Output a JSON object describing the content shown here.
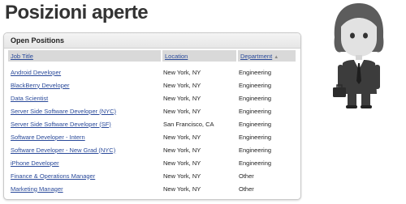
{
  "page": {
    "title": "Posizioni aperte"
  },
  "panel": {
    "title": "Open Positions"
  },
  "table": {
    "headers": {
      "job_title": "Job Title",
      "location": "Location",
      "department": "Department"
    },
    "rows": [
      {
        "title": "Android Developer",
        "location": "New York, NY",
        "department": "Engineering"
      },
      {
        "title": "BlackBerry Developer",
        "location": "New York, NY",
        "department": "Engineering"
      },
      {
        "title": "Data Scientist",
        "location": "New York, NY",
        "department": "Engineering"
      },
      {
        "title": "Server Side Software Developer (NYC)",
        "location": "New York, NY",
        "department": "Engineering"
      },
      {
        "title": "Server Side Software Developer (SF)",
        "location": "San Francisco, CA",
        "department": "Engineering"
      },
      {
        "title": "Software Developer - Intern",
        "location": "New York, NY",
        "department": "Engineering"
      },
      {
        "title": "Software Developer - New Grad (NYC)",
        "location": "New York, NY",
        "department": "Engineering"
      },
      {
        "title": "iPhone Developer",
        "location": "New York, NY",
        "department": "Engineering"
      },
      {
        "title": "Finance & Operations Manager",
        "location": "New York, NY",
        "department": "Other"
      },
      {
        "title": "Marketing Manager",
        "location": "New York, NY",
        "department": "Other"
      }
    ]
  },
  "icons": {
    "sort": "sort-arrow-icon",
    "avatar": "businessman-avatar-icon"
  },
  "colors": {
    "link": "#2a4a9a",
    "header_bg": "#d9d9d9",
    "title": "#333333"
  }
}
